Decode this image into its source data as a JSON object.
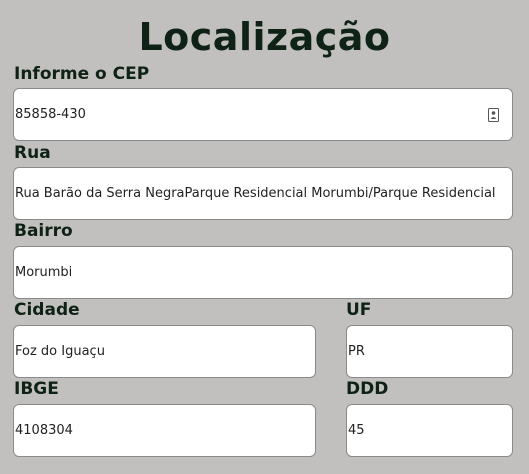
{
  "title": "Localização",
  "fields": {
    "cep": {
      "label": "Informe o CEP",
      "value": "85858-430",
      "icon": "contact-card-icon"
    },
    "rua": {
      "label": "Rua",
      "value": "Rua Barão da Serra NegraParque Residencial Morumbi/Parque Residencial"
    },
    "bairro": {
      "label": "Bairro",
      "value": "Morumbi"
    },
    "cidade": {
      "label": "Cidade",
      "value": "Foz do Iguaçu"
    },
    "uf": {
      "label": "UF",
      "value": "PR"
    },
    "ibge": {
      "label": "IBGE",
      "value": "4108304"
    },
    "ddd": {
      "label": "DDD",
      "value": "45"
    }
  },
  "colors": {
    "background": "#c2c0bf",
    "text": "#0e2215",
    "field_background": "#ffffff",
    "field_border": "#8a8a8a"
  }
}
